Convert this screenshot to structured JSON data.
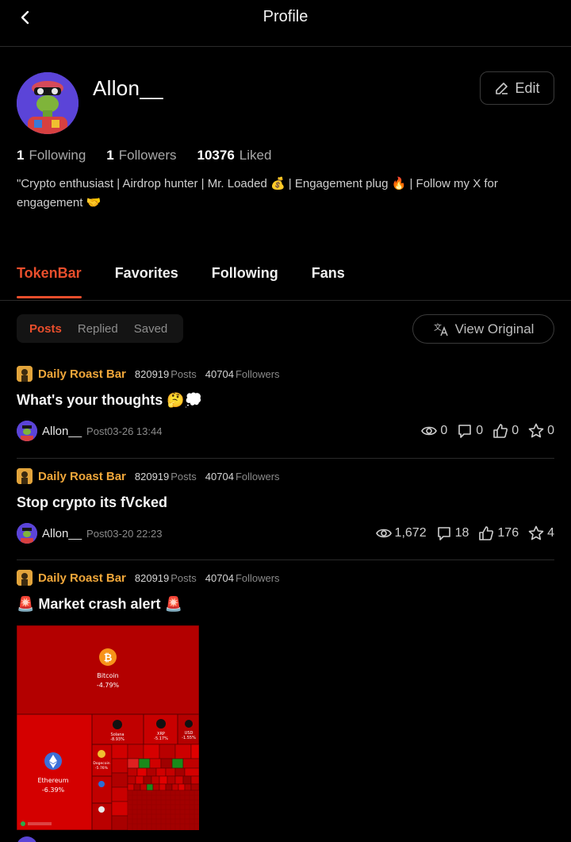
{
  "header": {
    "title": "Profile"
  },
  "profile": {
    "username": "Allon__",
    "edit_label": "Edit",
    "stats": {
      "following_count": "1",
      "following_label": "Following",
      "followers_count": "1",
      "followers_label": "Followers",
      "liked_count": "10376",
      "liked_label": "Liked"
    },
    "bio": "\"Crypto enthusiast | Airdrop hunter | Mr. Loaded 💰 | Engagement plug 🔥 | Follow my X for engagement 🤝"
  },
  "tabs": [
    "TokenBar",
    "Favorites",
    "Following",
    "Fans"
  ],
  "subtabs": [
    "Posts",
    "Replied",
    "Saved"
  ],
  "view_original_label": "View Original",
  "posts": [
    {
      "source": {
        "name": "Daily Roast Bar",
        "posts_count": "820919",
        "posts_label": "Posts",
        "followers_count": "40704",
        "followers_label": "Followers"
      },
      "title": "What's your thoughts 🤔💭",
      "author": "Allon__",
      "time": "Post03-26 13:44",
      "views": "0",
      "comments": "0",
      "likes": "0",
      "stars": "0"
    },
    {
      "source": {
        "name": "Daily Roast Bar",
        "posts_count": "820919",
        "posts_label": "Posts",
        "followers_count": "40704",
        "followers_label": "Followers"
      },
      "title": "Stop crypto its fVcked",
      "author": "Allon__",
      "time": "Post03-20 22:23",
      "views": "1,672",
      "comments": "18",
      "likes": "176",
      "stars": "4"
    },
    {
      "source": {
        "name": "Daily Roast Bar",
        "posts_count": "820919",
        "posts_label": "Posts",
        "followers_count": "40704",
        "followers_label": "Followers"
      },
      "title": "🚨 Market crash alert 🚨"
    }
  ],
  "heatmap_image": {
    "bitcoin_name": "Bitcoin",
    "bitcoin_change": "-4.79%",
    "ethereum_name": "Ethereum",
    "ethereum_change": "-6.39%",
    "solana_name": "Solana",
    "solana_change": "-8.93%",
    "xrp_name": "XRP",
    "xrp_change": "-5.17%",
    "usd_name": "USD",
    "usd_change": "-1.55%",
    "doge_name": "Dogecoin",
    "doge_change": "-5.76%"
  },
  "colors": {
    "accent": "#e84e2c",
    "source": "#f0a73a",
    "heatmap_red": "#c20000"
  }
}
